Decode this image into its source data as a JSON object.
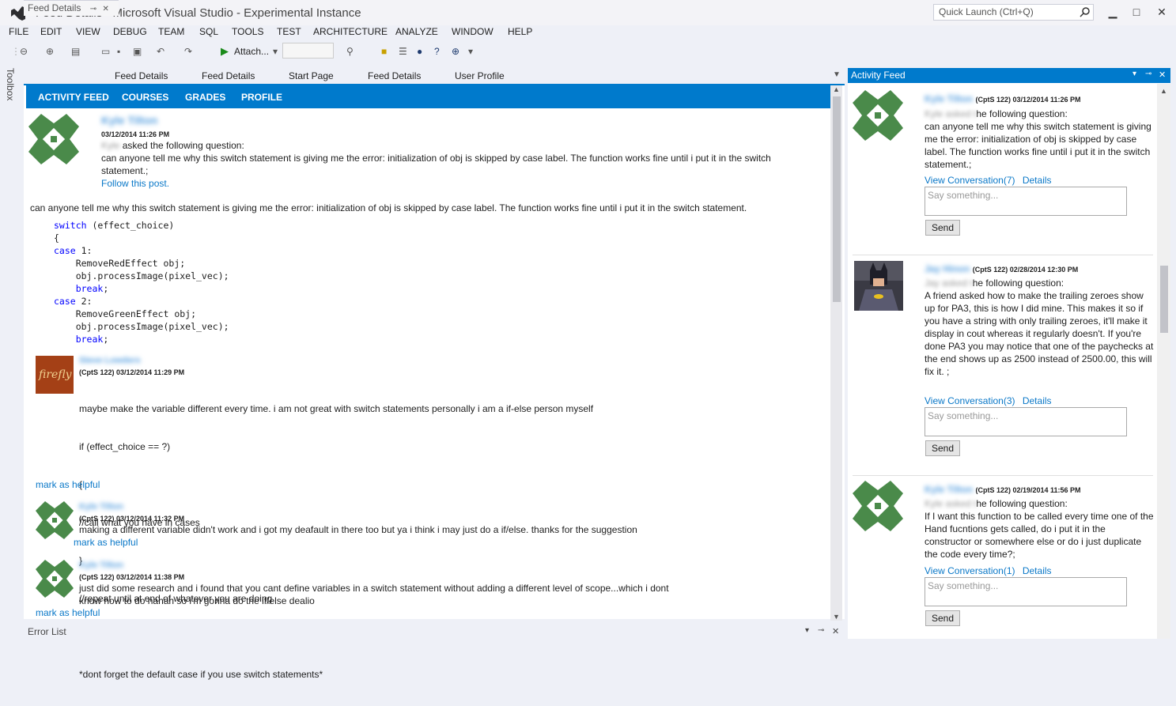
{
  "window": {
    "title": "Feed Details - Microsoft Visual Studio - Experimental Instance",
    "quick_launch_placeholder": "Quick Launch (Ctrl+Q)"
  },
  "menu": [
    "FILE",
    "EDIT",
    "VIEW",
    "DEBUG",
    "TEAM",
    "SQL",
    "TOOLS",
    "TEST",
    "ARCHITECTURE",
    "ANALYZE",
    "WINDOW",
    "HELP"
  ],
  "toolbar": {
    "attach_label": "Attach..."
  },
  "toolbox_label": "Toolbox",
  "doc_tabs": [
    "Feed Details",
    "Feed Details",
    "Feed Details",
    "Start Page",
    "Feed Details",
    "User Profile"
  ],
  "feed_nav": [
    "ACTIVITY FEED",
    "COURSES",
    "GRADES",
    "PROFILE"
  ],
  "post": {
    "author": "Kyle Tilton",
    "timestamp": "03/12/2014 11:26 PM",
    "prefix": "Kyle",
    "asked": "asked the following question:",
    "question": "can anyone tell me why this switch statement is giving me the error: initialization of obj is skipped by case label. The function works fine until i put it in the switch statement.;",
    "follow": "Follow this post.",
    "body": "can anyone tell me why this switch statement is giving me the error: initialization of obj is skipped by case label. The function works fine until i put it in the switch statement.",
    "code": [
      {
        "kw": "switch",
        "rest": " (effect_choice)"
      },
      {
        "kw": "",
        "rest": "{"
      },
      {
        "kw": "case",
        "rest": " 1:"
      },
      {
        "kw": "",
        "rest": "    RemoveRedEffect obj;"
      },
      {
        "kw": "",
        "rest": "    obj.processImage(pixel_vec);"
      },
      {
        "kw": "    break",
        "rest": ";"
      },
      {
        "kw": "case",
        "rest": " 2:"
      },
      {
        "kw": "",
        "rest": "    RemoveGreenEffect obj;"
      },
      {
        "kw": "",
        "rest": "    obj.processImage(pixel_vec);"
      },
      {
        "kw": "    break",
        "rest": ";"
      }
    ]
  },
  "replies": [
    {
      "author": "Steve Lowders",
      "meta": "(CptS 122) 03/12/2014 11:29 PM",
      "lines": [
        "maybe make the variable different every time. i am not great with switch statements personally i am a if-else person myself",
        "if (effect_choice == ?)",
        "{",
        "//call what you have in cases",
        "}",
        "//repeat until at end of whatever you are doing",
        "",
        "*dont forget the default case if you use switch statements*"
      ],
      "helpful": "mark as helpful"
    },
    {
      "author": "Kyle Tilton",
      "meta": "(CptS 122) 03/12/2014 11:32 PM",
      "lines": [
        "making a different variable didn't work and i got my deafault in there too but ya i think i may just do a if/else. thanks for the suggestion"
      ],
      "helpful": "mark as helpful"
    },
    {
      "author": "Kyle Tilton",
      "meta": "(CptS 122) 03/12/2014 11:38 PM",
      "lines": [
        "just did some research and i found that you cant define variables in a switch statement without adding a different level of scope...which i dont",
        "know how to do hahah so i'm gonna do the if/else dealio"
      ],
      "helpful": "mark as helpful"
    }
  ],
  "activity_panel": {
    "title": "Activity Feed",
    "items": [
      {
        "author": "Kyle Tilton",
        "meta": "(CptS 122) 03/12/2014 11:26 PM",
        "asked_prefix": "Kyle asked t",
        "asked": "he following question:",
        "text": "can anyone tell me why this switch statement is giving me the error: initialization of obj is skipped by case label. The function works fine until i put it in the switch statement.;",
        "view": "View Conversation(7)",
        "details": "Details",
        "say": "Say something...",
        "send": "Send"
      },
      {
        "author": "Jay Hinon",
        "meta": "(CptS 122) 02/28/2014 12:30 PM",
        "asked_prefix": "Jay asked t",
        "asked": "he following question:",
        "text": "A friend asked how to make the trailing zeroes show up for PA3, this is how I did mine. This makes it so if you have a string with only trailing zeroes, it'll make it display in cout whereas it regularly doesn't. If you're done PA3 you may notice that one of the paychecks at the end shows up as 2500 instead of 2500.00, this will fix it. ;",
        "view": "View Conversation(3)",
        "details": "Details",
        "say": "Say something...",
        "send": "Send"
      },
      {
        "author": "Kyle Tilton",
        "meta": "(CptS 122) 02/19/2014 11:56 PM",
        "asked_prefix": "Kyle asked t",
        "asked": "he following question:",
        "text": "If I want this function to be called every time one of the Hand fucntions gets called, do i put it in the constructor or somewhere else or do i just duplicate the code every time?;",
        "view": "View Conversation(1)",
        "details": "Details",
        "say": "Say something...",
        "send": "Send"
      }
    ]
  },
  "bottom_panel": {
    "title": "Error List"
  },
  "colors": {
    "accent": "#007acc",
    "avatar_green": "#4a8a4a",
    "link": "#0a78c8"
  }
}
